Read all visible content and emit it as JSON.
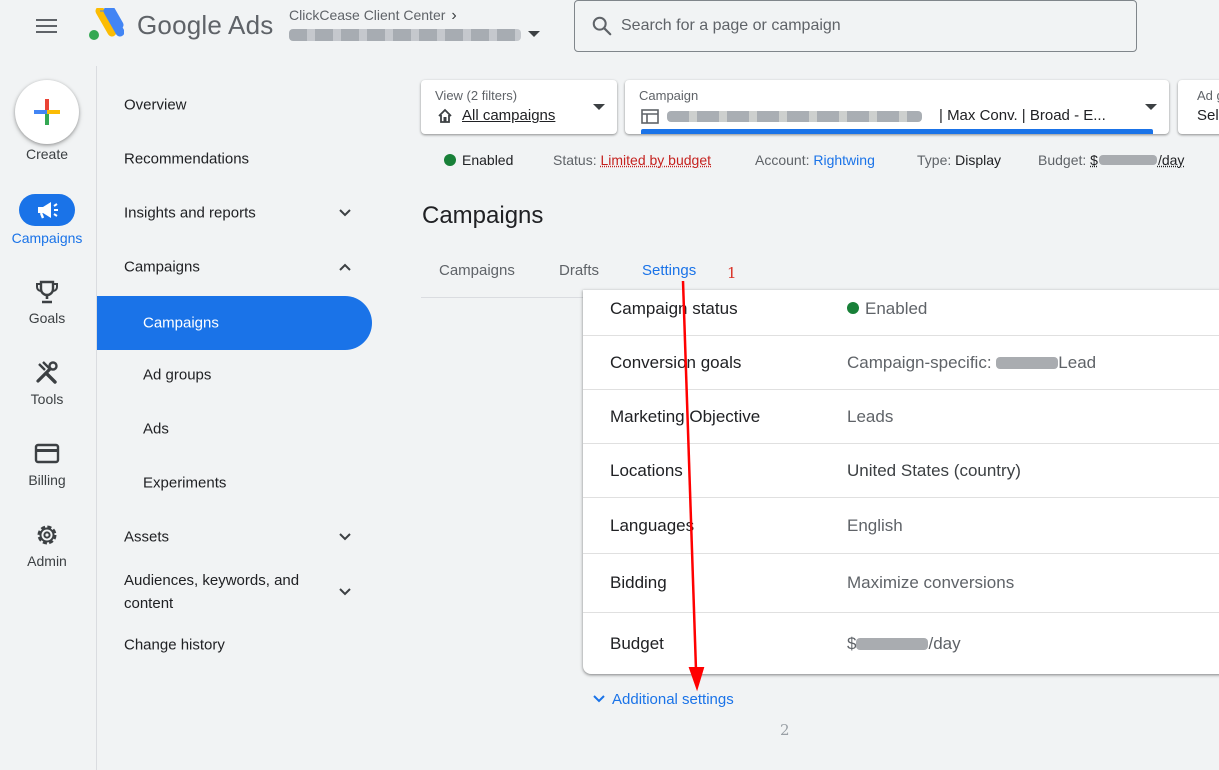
{
  "header": {
    "brand": "Google Ads",
    "client_center": "ClickCease Client Center",
    "search_placeholder": "Search for a page or campaign"
  },
  "rail": {
    "create": "Create",
    "campaigns": "Campaigns",
    "goals": "Goals",
    "tools": "Tools",
    "billing": "Billing",
    "admin": "Admin"
  },
  "sidenav": {
    "overview": "Overview",
    "recommendations": "Recommendations",
    "insights": "Insights and reports",
    "campaigns_group": "Campaigns",
    "campaigns": "Campaigns",
    "ad_groups": "Ad groups",
    "ads": "Ads",
    "experiments": "Experiments",
    "assets": "Assets",
    "audiences": "Audiences, keywords, and content",
    "change_history": "Change history"
  },
  "filters": {
    "view_label": "View (2 filters)",
    "view_value": "All campaigns",
    "campaign_label": "Campaign",
    "campaign_value": "| Max Conv. | Broad - E...",
    "ad_label": "Ad g",
    "ad_value": "Sel"
  },
  "status": {
    "enabled": "Enabled",
    "status_label": "Status:",
    "status_value": "Limited by budget",
    "account_label": "Account:",
    "account_value": "Rightwing",
    "type_label": "Type:",
    "type_value": "Display",
    "budget_label": "Budget:",
    "budget_prefix": "$",
    "budget_suffix": "/day"
  },
  "page": {
    "title": "Campaigns",
    "tabs": [
      "Campaigns",
      "Drafts",
      "Settings"
    ]
  },
  "settings": {
    "rows": [
      {
        "key": "Campaign status",
        "value": "Enabled"
      },
      {
        "key": "Conversion goals",
        "value_prefix": "Campaign-specific: ",
        "value_suffix": "Lead"
      },
      {
        "key": "Marketing Objective",
        "value": "Leads"
      },
      {
        "key": "Locations",
        "value": "United States (country)"
      },
      {
        "key": "Languages",
        "value": "English"
      },
      {
        "key": "Bidding",
        "value": "Maximize conversions"
      },
      {
        "key": "Budget",
        "value_prefix": "$",
        "value_suffix": "/day"
      }
    ],
    "additional": "Additional settings"
  },
  "annotations": {
    "marker_1": "1",
    "marker_2": "2"
  },
  "colors": {
    "accent": "#1a73e8",
    "enabled_green": "#188038",
    "limited_red": "#c5221f",
    "annotation_red": "#ff0000"
  }
}
